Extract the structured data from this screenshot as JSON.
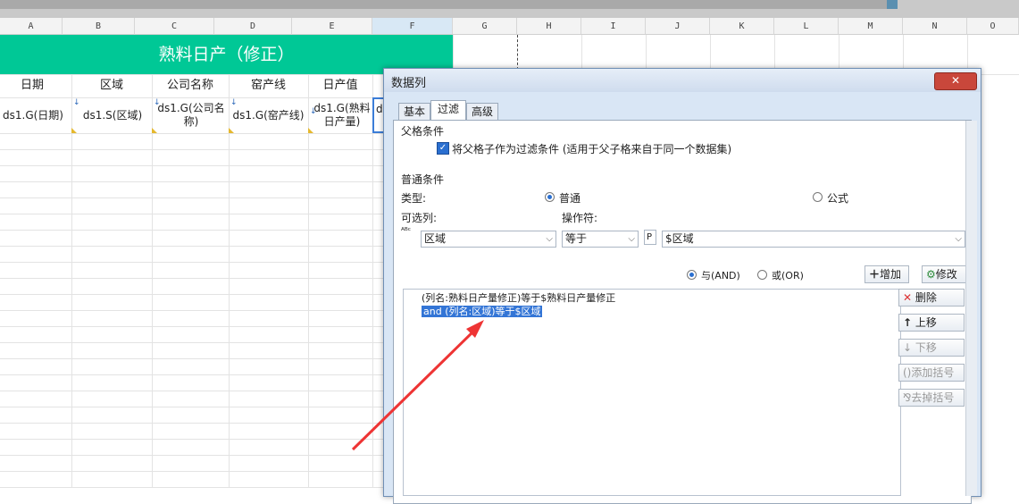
{
  "columns": [
    "A",
    "B",
    "C",
    "D",
    "E",
    "F",
    "G",
    "H",
    "I",
    "J",
    "K",
    "L",
    "M",
    "N",
    "O"
  ],
  "sheet": {
    "title": "熟料日产（修正）",
    "headers": [
      "日期",
      "区域",
      "公司名称",
      "窑产线",
      "日产值"
    ],
    "cells": [
      "ds1.G(日期)",
      "ds1.S(区域)",
      "ds1.G(公司名称)",
      "ds1.G(窑产线)",
      "ds1.G(熟料日产量)",
      "d"
    ],
    "colors": {
      "banner": "#00c896",
      "selection": "#3b7dd8"
    }
  },
  "dialog": {
    "title": "数据列",
    "close_icon": "close-icon",
    "tabs": [
      "基本",
      "过滤",
      "高级"
    ],
    "active_tab": "过滤",
    "parent_section": {
      "title": "父格条件",
      "checkbox_label": "将父格子作为过滤条件 (适用于父子格来自于同一个数据集)",
      "checked": true
    },
    "normal_section": {
      "title": "普通条件",
      "type_label": "类型:",
      "type_options": [
        "普通",
        "公式"
      ],
      "type_selected": "普通",
      "column_label": "可选列:",
      "operator_label": "操作符:",
      "column_value": "区域",
      "operator_value": "等于",
      "param_value": "$区域",
      "and_label": "与(AND)",
      "or_label": "或(OR)",
      "logic_selected": "与(AND)",
      "add_label": "增加",
      "modify_label": "修改"
    },
    "conditions": [
      "(列名:熟料日产量修正)等于$熟料日产量修正",
      "and (列名:区域)等于$区域"
    ],
    "side_buttons": [
      {
        "label": "删除",
        "enabled": true
      },
      {
        "label": "上移",
        "enabled": true
      },
      {
        "label": "下移",
        "enabled": false
      },
      {
        "label": "添加括号",
        "enabled": false
      },
      {
        "label": "去掉括号",
        "enabled": false
      }
    ]
  }
}
